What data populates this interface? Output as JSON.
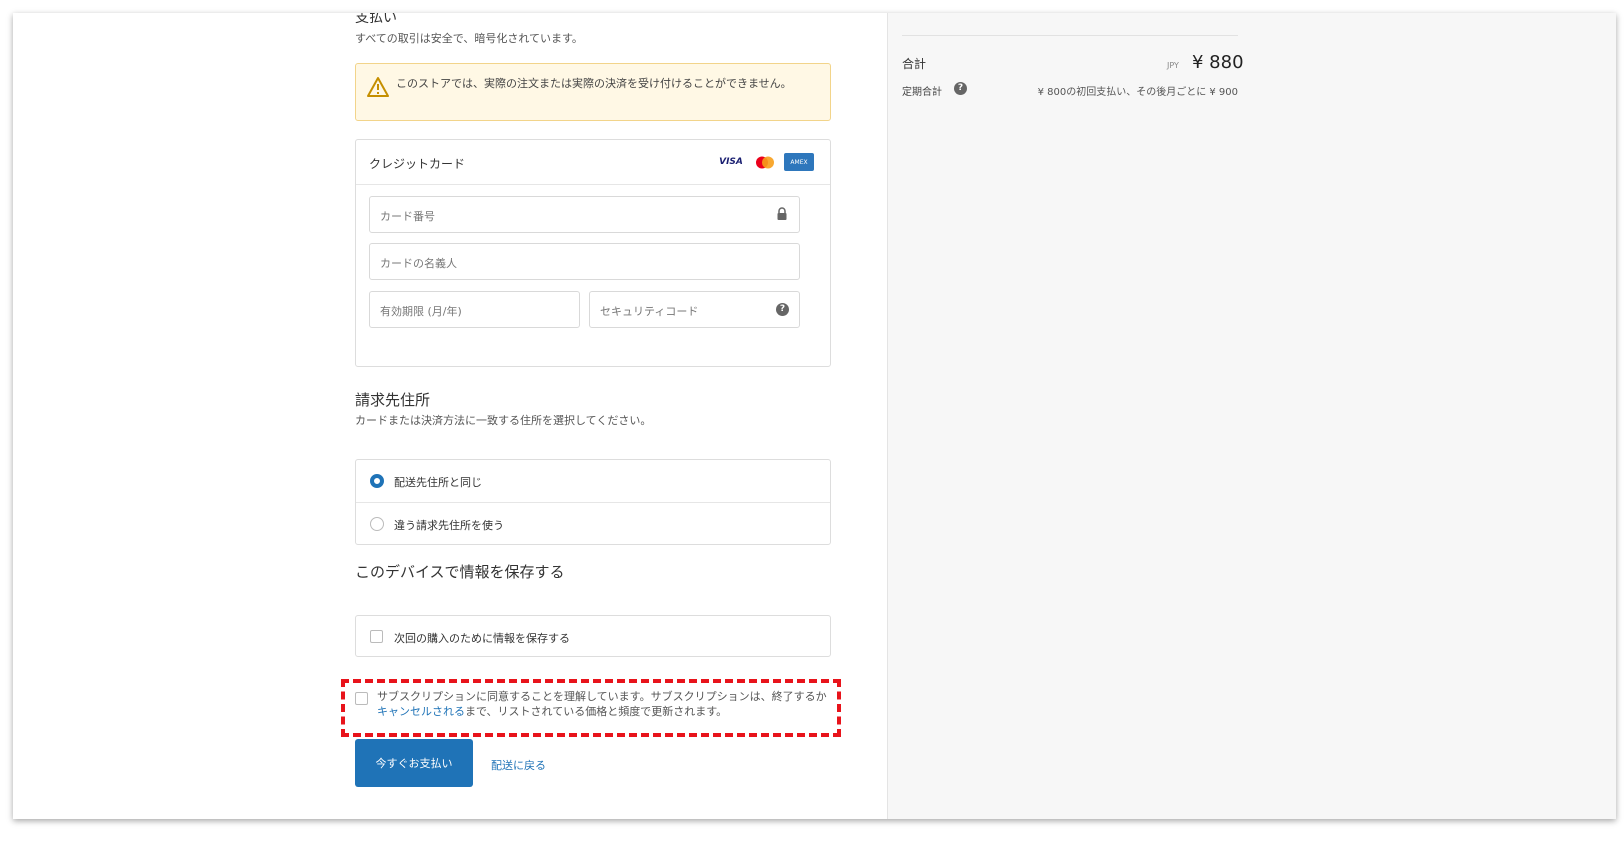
{
  "payment": {
    "title": "支払い",
    "subtitle": "すべての取引は安全で、暗号化されています。",
    "warning": "このストアでは、実際の注文または実際の決済を受け付けることができません。",
    "card_label": "クレジットカード",
    "card_brands": [
      "VISA",
      "mastercard",
      "AMEX"
    ],
    "card_number_placeholder": "カード番号",
    "card_name_placeholder": "カードの名義人",
    "expiry_placeholder": "有効期限 (月/年)",
    "cvc_placeholder": "セキュリティコード"
  },
  "billing": {
    "title": "請求先住所",
    "subtitle": "カードまたは決済方法に一致する住所を選択してください。",
    "options": [
      {
        "label": "配送先住所と同じ",
        "selected": true
      },
      {
        "label": "違う請求先住所を使う",
        "selected": false
      }
    ]
  },
  "save_info": {
    "title": "このデバイスで情報を保存する",
    "checkbox_label": "次回の購入のために情報を保存する",
    "checked": false
  },
  "terms": {
    "text_before": "サブスクリプションに同意することを理解しています。サブスクリプションは、終了するか ",
    "link": "キャンセルされる",
    "text_after": "まで、リストされている価格と頻度で更新されます。",
    "checked": false
  },
  "actions": {
    "pay_now": "今すぐお支払い",
    "back_to_shipping": "配送に戻る"
  },
  "summary": {
    "total_label": "合計",
    "currency": "JPY",
    "amount": "¥ 880",
    "recurring_label": "定期合計",
    "recurring_desc": "¥ 800の初回支払い、その後月ごとに ¥ 900"
  },
  "colors": {
    "accent": "#1f73b7",
    "warning_bg": "#fff8e5",
    "highlight": "#e8131b"
  },
  "icons": {
    "warning": "warning-triangle-icon",
    "lock": "lock-icon",
    "help": "question-circle-icon"
  }
}
